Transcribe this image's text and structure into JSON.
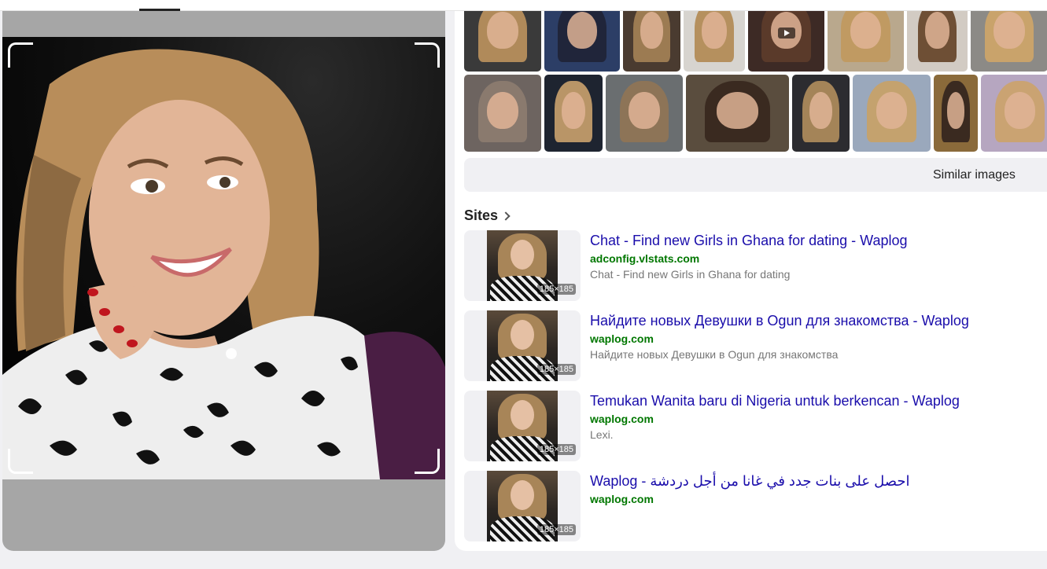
{
  "similar_images_label": "Similar images",
  "sites_heading": "Sites",
  "thumbnails_row1": [
    {
      "w": 98,
      "bg": "#3a3a3a",
      "hair": "#b08a5a"
    },
    {
      "w": 96,
      "bg": "#2c3e66",
      "hair": "#20253a"
    },
    {
      "w": 73,
      "bg": "#4a3b30",
      "hair": "#9c7b52"
    },
    {
      "w": 78,
      "bg": "#d7d4cf",
      "hair": "#b5905e"
    },
    {
      "w": 97,
      "bg": "#3d2a25",
      "hair": "#5a3a2a",
      "play": true
    },
    {
      "w": 97,
      "bg": "#b9a88d",
      "hair": "#c09a62"
    },
    {
      "w": 77,
      "bg": "#d2cbc3",
      "hair": "#6e4f35"
    },
    {
      "w": 98,
      "bg": "#8c8a86",
      "hair": "#c9a36b"
    }
  ],
  "thumbnails_row2": [
    {
      "w": 98,
      "bg": "#6d6460",
      "hair": "#8a7a6e"
    },
    {
      "w": 74,
      "bg": "#1e2430",
      "hair": "#b99567"
    },
    {
      "w": 98,
      "bg": "#6a6e70",
      "hair": "#8d7457"
    },
    {
      "w": 131,
      "bg": "#5a4d3e",
      "hair": "#3a2a20"
    },
    {
      "w": 73,
      "bg": "#2c2c30",
      "hair": "#a48458"
    },
    {
      "w": 99,
      "bg": "#9aa8bc",
      "hair": "#c4a26e"
    },
    {
      "w": 56,
      "bg": "#8a6a3a",
      "hair": "#3a2a20"
    },
    {
      "w": 99,
      "bg": "#b6a6c0",
      "hair": "#caa372"
    }
  ],
  "sites": [
    {
      "title": "Chat - Find new Girls in Ghana for dating - Waplog",
      "domain": "adconfig.vlstats.com",
      "description": "Chat - Find new Girls in Ghana for dating",
      "size": "185×185"
    },
    {
      "title": "Найдите новых Девушки в Ogun для знакомства - Waplog",
      "domain": "waplog.com",
      "description": "Найдите новых Девушки в Ogun для знакомства",
      "size": "185×185"
    },
    {
      "title": "Temukan Wanita baru di Nigeria untuk berkencan - Waplog",
      "domain": "waplog.com",
      "description": "Lexi.",
      "size": "185×185"
    },
    {
      "title": "احصل على بنات جدد في غانا من أجل دردشة - Waplog",
      "domain": "waplog.com",
      "description": "",
      "size": "185×185"
    }
  ],
  "colors": {
    "link": "#1a0dab",
    "domain": "#007700",
    "muted": "#777777"
  }
}
